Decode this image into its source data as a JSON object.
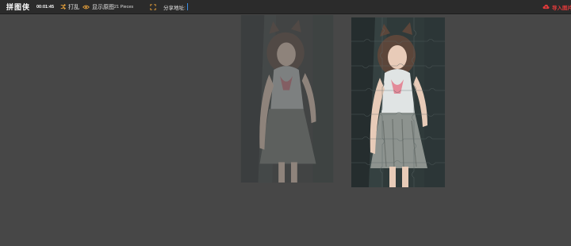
{
  "toolbar": {
    "app_title": "拼图侠",
    "timer": "00:01:45",
    "shuffle_label": "打乱",
    "show_original_label": "显示原图",
    "pieces_label": "21 Pieces",
    "share_label": "分享地址:",
    "import_label": "导入图片"
  },
  "icons": {
    "shuffle": "shuffle-icon",
    "show_original": "eye-icon",
    "fullscreen": "fullscreen-icon",
    "import": "cloud-upload-icon"
  },
  "colors": {
    "background": "#474747",
    "toolbar": "#2b2b2b",
    "accent_orange": "#e8a13a",
    "import_red": "#e03a3a"
  },
  "puzzle": {
    "pieces": 21
  }
}
